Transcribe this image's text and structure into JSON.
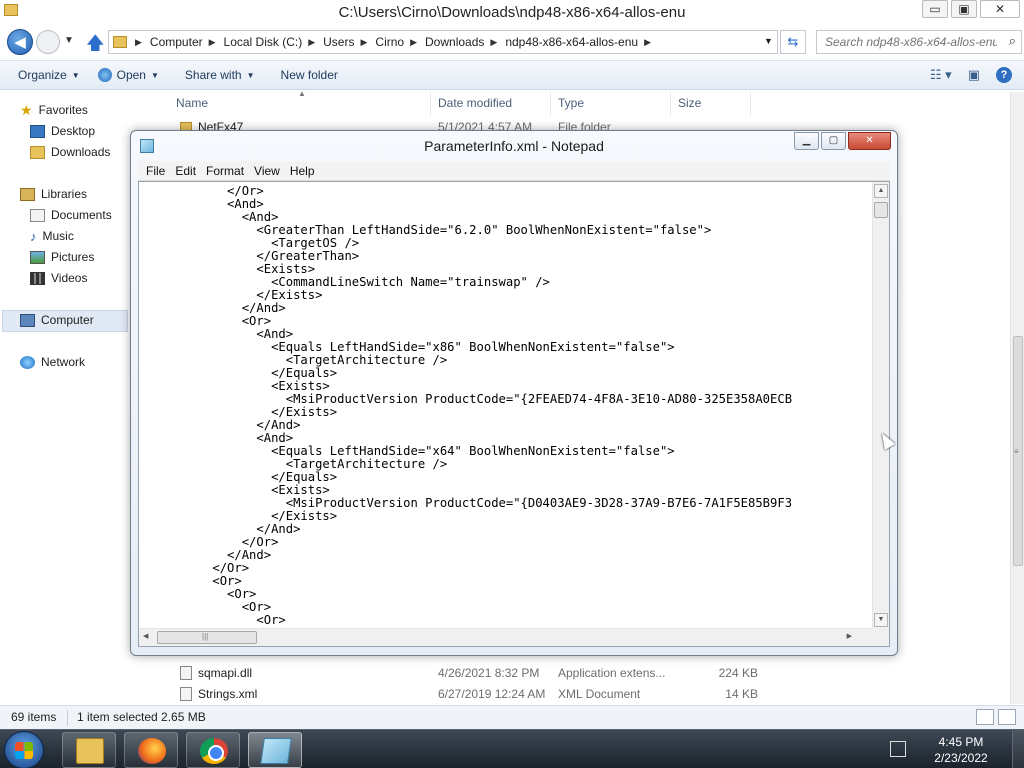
{
  "explorer": {
    "title": "C:\\Users\\Cirno\\Downloads\\ndp48-x86-x64-allos-enu",
    "window_buttons": {
      "minimize": "▭",
      "maximize": "▣",
      "close": "✕"
    },
    "breadcrumb": [
      "Computer",
      "Local Disk (C:)",
      "Users",
      "Cirno",
      "Downloads",
      "ndp48-x86-x64-allos-enu"
    ],
    "search_placeholder": "Search ndp48-x86-x64-allos-enu",
    "commands": {
      "organize": "Organize",
      "open": "Open",
      "share_with": "Share with",
      "new_folder": "New folder"
    },
    "nav": {
      "favorites": "Favorites",
      "desktop": "Desktop",
      "downloads": "Downloads",
      "libraries": "Libraries",
      "documents": "Documents",
      "music": "Music",
      "pictures": "Pictures",
      "videos": "Videos",
      "computer": "Computer",
      "network": "Network"
    },
    "columns": {
      "name": "Name",
      "date": "Date modified",
      "type": "Type",
      "size": "Size"
    },
    "files": [
      {
        "name": "NetFx47",
        "date": "5/1/2021 4:57 AM",
        "type": "File folder",
        "size": ""
      },
      {
        "name": "sqmapi.dll",
        "date": "4/26/2021 8:32 PM",
        "type": "Application extens...",
        "size": "224 KB"
      },
      {
        "name": "Strings.xml",
        "date": "6/27/2019 12:24 AM",
        "type": "XML Document",
        "size": "14 KB"
      }
    ],
    "status": {
      "count": "69 items",
      "selected": "1 item selected  2.65 MB"
    }
  },
  "notepad": {
    "title": "ParameterInfo.xml - Notepad",
    "menu": [
      "File",
      "Edit",
      "Format",
      "View",
      "Help"
    ],
    "lines": [
      "            </Or>",
      "            <And>",
      "              <And>",
      "                <GreaterThan LeftHandSide=\"6.2.0\" BoolWhenNonExistent=\"false\">",
      "                  <TargetOS />",
      "                </GreaterThan>",
      "                <Exists>",
      "                  <CommandLineSwitch Name=\"trainswap\" />",
      "                </Exists>",
      "              </And>",
      "              <Or>",
      "                <And>",
      "                  <Equals LeftHandSide=\"x86\" BoolWhenNonExistent=\"false\">",
      "                    <TargetArchitecture />",
      "                  </Equals>",
      "                  <Exists>",
      "                    <MsiProductVersion ProductCode=\"{2FEAED74-4F8A-3E10-AD80-325E358A0ECB",
      "                  </Exists>",
      "                </And>",
      "                <And>",
      "                  <Equals LeftHandSide=\"x64\" BoolWhenNonExistent=\"false\">",
      "                    <TargetArchitecture />",
      "                  </Equals>",
      "                  <Exists>",
      "                    <MsiProductVersion ProductCode=\"{D0403AE9-3D28-37A9-B7E6-7A1F5E85B9F3",
      "                  </Exists>",
      "                </And>",
      "              </Or>",
      "            </And>",
      "          </Or>",
      "          <Or>",
      "            <Or>",
      "              <Or>",
      "                <Or>"
    ]
  },
  "taskbar": {
    "time": "4:45 PM",
    "date": "2/23/2022"
  }
}
